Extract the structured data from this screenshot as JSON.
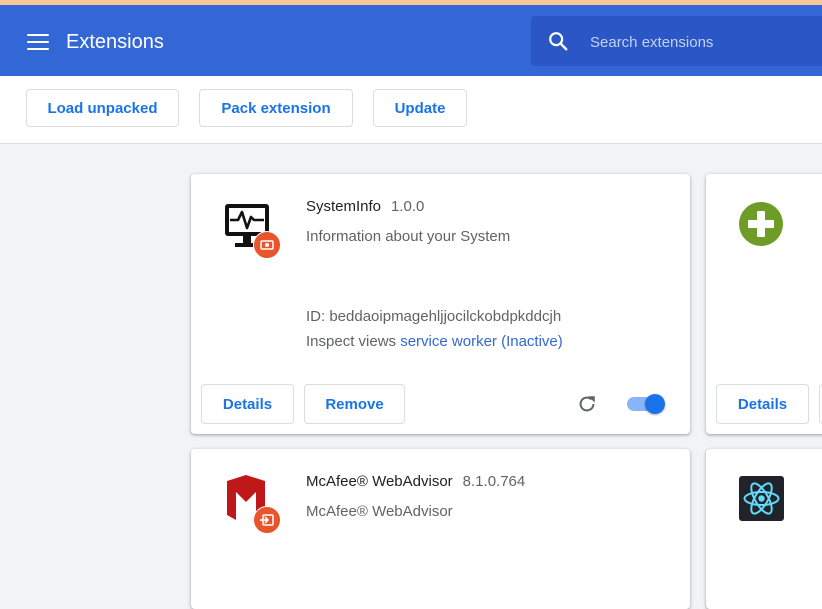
{
  "header": {
    "title": "Extensions",
    "menu_icon": "hamburger-menu-icon",
    "search": {
      "placeholder": "Search extensions",
      "icon": "search-icon"
    }
  },
  "toolbar": {
    "load_unpacked": "Load unpacked",
    "pack_extension": "Pack extension",
    "update": "Update"
  },
  "extensions": [
    {
      "name": "SystemInfo",
      "version": "1.0.0",
      "description": "Information about your System",
      "id_label": "ID: beddaoipmagehljjocilckobdpkddcjh",
      "inspect_label": "Inspect views",
      "inspect_link": "service worker (Inactive)",
      "details_label": "Details",
      "remove_label": "Remove",
      "icon": "monitor-heartbeat-icon",
      "badge_icon": "policy-badge-icon",
      "enabled": true
    },
    {
      "name": "McAfee® WebAdvisor",
      "version": "8.1.0.764",
      "description": "McAfee® WebAdvisor",
      "icon": "mcafee-shield-icon",
      "badge_icon": "policy-badge-icon"
    },
    {
      "icon": "green-plus-icon",
      "details_label": "Details"
    },
    {
      "icon": "react-atom-icon"
    }
  ],
  "colors": {
    "header": "#3367d6",
    "accent": "#1a73e8",
    "badge": "#e8552d"
  }
}
